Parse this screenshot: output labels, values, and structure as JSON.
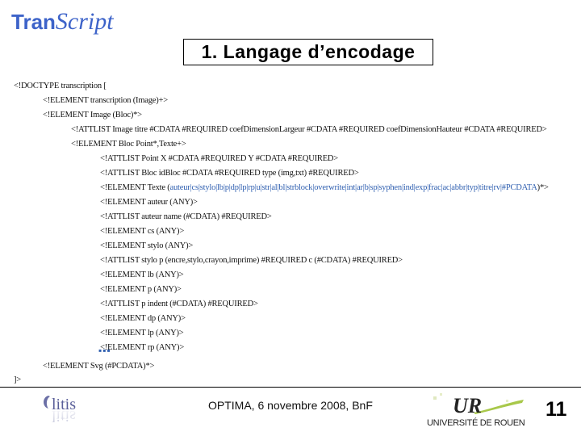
{
  "header": {
    "logo": {
      "part1": "Tran",
      "part2": "Script",
      "color": "#3d63c9"
    },
    "title": "1. Langage d’encodage"
  },
  "dtd": {
    "lines": [
      {
        "level": 0,
        "text": "<!DOCTYPE transcription ["
      },
      {
        "level": 1,
        "text": "<!ELEMENT transcription (Image)+>"
      },
      {
        "level": 1,
        "text": "<!ELEMENT Image (Bloc)*>"
      },
      {
        "level": 2,
        "text": "<!ATTLIST Image titre #CDATA #REQUIRED coefDimensionLargeur #CDATA #REQUIRED coefDimensionHauteur #CDATA #REQUIRED>"
      },
      {
        "level": 2,
        "text": "<!ELEMENT Bloc Point*,Texte+>"
      },
      {
        "level": 3,
        "text": "<!ATTLIST Point X #CDATA #REQUIRED Y #CDATA #REQUIRED>"
      },
      {
        "level": 3,
        "text": "<!ATTLIST Bloc idBloc #CDATA #REQUIRED type (img,txt) #REQUIRED>"
      },
      {
        "level": 3,
        "prefix": "<!ELEMENT Texte (",
        "highlight": "auteur|cs|stylo|lb|p|dp|lp|rp|u|str|al|bl|strblock|overwrite|int|ar|b|sp|syphen|ind|exp|frac|ac|abbr|typ|titre|rv|#PCDATA",
        "suffix": ")*>"
      },
      {
        "level": 3,
        "text": "<!ELEMENT auteur (ANY)>"
      },
      {
        "level": 3,
        "text": "<!ATTLIST auteur name (#CDATA) #REQUIRED>"
      },
      {
        "level": 3,
        "text": "<!ELEMENT cs (ANY)>"
      },
      {
        "level": 3,
        "text": "<!ELEMENT stylo (ANY)>"
      },
      {
        "level": 3,
        "text": "<!ATTLIST stylo p (encre,stylo,crayon,imprime) #REQUIRED c (#CDATA) #REQUIRED>"
      },
      {
        "level": 3,
        "text": "<!ELEMENT lb (ANY)>"
      },
      {
        "level": 3,
        "text": "<!ELEMENT p (ANY)>"
      },
      {
        "level": 3,
        "text": "<!ATTLIST p indent (#CDATA) #REQUIRED>"
      },
      {
        "level": 3,
        "text": "<!ELEMENT dp (ANY)>"
      },
      {
        "level": 3,
        "text": "<!ELEMENT lp (ANY)>"
      },
      {
        "level": 3,
        "text": "<!ELEMENT rp (ANY)>"
      }
    ],
    "ellipsis": "▪▪▪",
    "svg_line": "<!ELEMENT Svg (#PCDATA)*>",
    "closing": "]>"
  },
  "footer": {
    "left_logo": "litis",
    "text": "OPTIMA, 6 novembre 2008, BnF",
    "right_logo": {
      "mark": "UR",
      "label": "UNIVERSITÉ DE ROUEN"
    },
    "page_number": "11"
  }
}
